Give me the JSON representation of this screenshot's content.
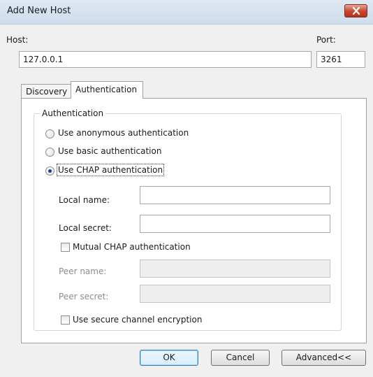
{
  "window": {
    "title": "Add New Host"
  },
  "host": {
    "label": "Host:",
    "value": "127.0.0.1"
  },
  "port": {
    "label": "Port:",
    "value": "3261"
  },
  "tabs": [
    {
      "label": "Discovery",
      "active": false
    },
    {
      "label": "Authentication",
      "active": true
    }
  ],
  "auth": {
    "group_label": "Authentication",
    "options": [
      {
        "label": "Use anonymous authentication",
        "checked": false
      },
      {
        "label": "Use basic authentication",
        "checked": false
      },
      {
        "label": "Use CHAP authentication",
        "checked": true
      }
    ],
    "local_name": {
      "label": "Local name:",
      "value": ""
    },
    "local_secret": {
      "label": "Local secret:",
      "value": ""
    },
    "mutual_chap": {
      "label": "Mutual CHAP authentication",
      "checked": false
    },
    "peer_name": {
      "label": "Peer name:",
      "value": ""
    },
    "peer_secret": {
      "label": "Peer secret:",
      "value": ""
    },
    "secure_channel": {
      "label": "Use secure channel encryption",
      "checked": false
    }
  },
  "buttons": {
    "ok": "OK",
    "cancel": "Cancel",
    "advanced": "Advanced<<"
  },
  "colors": {
    "title_bar": "#dfe8f3",
    "close_button": "#c8442d",
    "dialog_bg": "#f0f0f0"
  }
}
